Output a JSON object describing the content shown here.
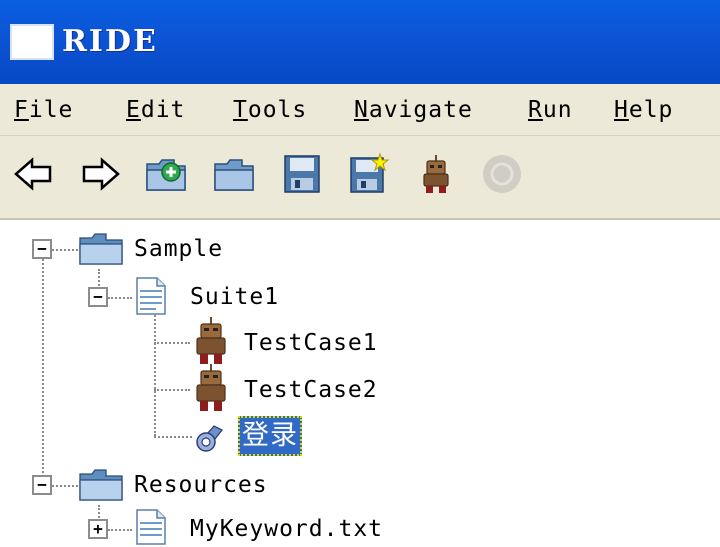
{
  "window": {
    "title": "RIDE"
  },
  "menu": [
    {
      "accel": "F",
      "rest": "ile"
    },
    {
      "accel": "E",
      "rest": "dit"
    },
    {
      "accel": "T",
      "rest": "ools"
    },
    {
      "accel": "N",
      "rest": "avigate"
    },
    {
      "accel": "R",
      "rest": "un"
    },
    {
      "accel": "H",
      "rest": "elp"
    }
  ],
  "toolbar": {
    "icons": [
      "back-arrow-icon",
      "forward-arrow-icon",
      "open-suite-icon",
      "open-directory-icon",
      "save-icon",
      "save-all-icon",
      "run-robot-icon",
      "stop-circle-icon"
    ]
  },
  "tree": {
    "sample": "Sample",
    "suite1": "Suite1",
    "testcase1": "TestCase1",
    "testcase2": "TestCase2",
    "keyword": "登录",
    "resources": "Resources",
    "mykeyword": "MyKeyword.txt",
    "expand_minus": "−",
    "expand_plus": "+"
  },
  "colors": {
    "titlebar": "#0a5fe0",
    "chrome": "#ece9d8",
    "selection": "#316ac5"
  }
}
